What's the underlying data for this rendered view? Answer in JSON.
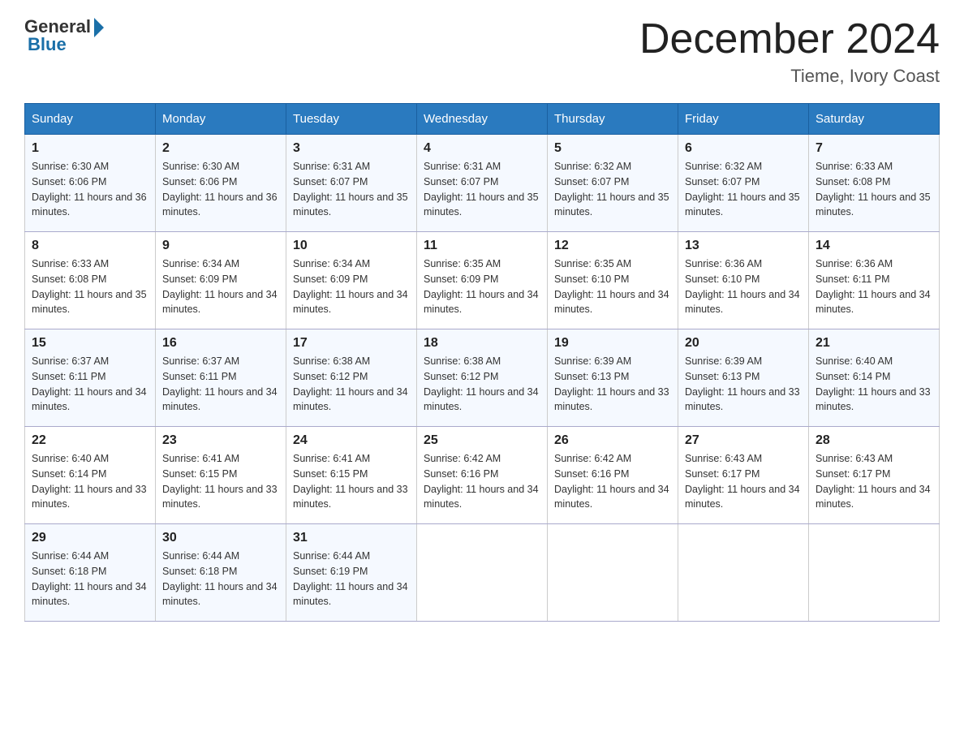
{
  "logo": {
    "general": "General",
    "blue": "Blue"
  },
  "title": "December 2024",
  "location": "Tieme, Ivory Coast",
  "days_of_week": [
    "Sunday",
    "Monday",
    "Tuesday",
    "Wednesday",
    "Thursday",
    "Friday",
    "Saturday"
  ],
  "weeks": [
    [
      {
        "day": "1",
        "sunrise": "6:30 AM",
        "sunset": "6:06 PM",
        "daylight": "11 hours and 36 minutes."
      },
      {
        "day": "2",
        "sunrise": "6:30 AM",
        "sunset": "6:06 PM",
        "daylight": "11 hours and 36 minutes."
      },
      {
        "day": "3",
        "sunrise": "6:31 AM",
        "sunset": "6:07 PM",
        "daylight": "11 hours and 35 minutes."
      },
      {
        "day": "4",
        "sunrise": "6:31 AM",
        "sunset": "6:07 PM",
        "daylight": "11 hours and 35 minutes."
      },
      {
        "day": "5",
        "sunrise": "6:32 AM",
        "sunset": "6:07 PM",
        "daylight": "11 hours and 35 minutes."
      },
      {
        "day": "6",
        "sunrise": "6:32 AM",
        "sunset": "6:07 PM",
        "daylight": "11 hours and 35 minutes."
      },
      {
        "day": "7",
        "sunrise": "6:33 AM",
        "sunset": "6:08 PM",
        "daylight": "11 hours and 35 minutes."
      }
    ],
    [
      {
        "day": "8",
        "sunrise": "6:33 AM",
        "sunset": "6:08 PM",
        "daylight": "11 hours and 35 minutes."
      },
      {
        "day": "9",
        "sunrise": "6:34 AM",
        "sunset": "6:09 PM",
        "daylight": "11 hours and 34 minutes."
      },
      {
        "day": "10",
        "sunrise": "6:34 AM",
        "sunset": "6:09 PM",
        "daylight": "11 hours and 34 minutes."
      },
      {
        "day": "11",
        "sunrise": "6:35 AM",
        "sunset": "6:09 PM",
        "daylight": "11 hours and 34 minutes."
      },
      {
        "day": "12",
        "sunrise": "6:35 AM",
        "sunset": "6:10 PM",
        "daylight": "11 hours and 34 minutes."
      },
      {
        "day": "13",
        "sunrise": "6:36 AM",
        "sunset": "6:10 PM",
        "daylight": "11 hours and 34 minutes."
      },
      {
        "day": "14",
        "sunrise": "6:36 AM",
        "sunset": "6:11 PM",
        "daylight": "11 hours and 34 minutes."
      }
    ],
    [
      {
        "day": "15",
        "sunrise": "6:37 AM",
        "sunset": "6:11 PM",
        "daylight": "11 hours and 34 minutes."
      },
      {
        "day": "16",
        "sunrise": "6:37 AM",
        "sunset": "6:11 PM",
        "daylight": "11 hours and 34 minutes."
      },
      {
        "day": "17",
        "sunrise": "6:38 AM",
        "sunset": "6:12 PM",
        "daylight": "11 hours and 34 minutes."
      },
      {
        "day": "18",
        "sunrise": "6:38 AM",
        "sunset": "6:12 PM",
        "daylight": "11 hours and 34 minutes."
      },
      {
        "day": "19",
        "sunrise": "6:39 AM",
        "sunset": "6:13 PM",
        "daylight": "11 hours and 33 minutes."
      },
      {
        "day": "20",
        "sunrise": "6:39 AM",
        "sunset": "6:13 PM",
        "daylight": "11 hours and 33 minutes."
      },
      {
        "day": "21",
        "sunrise": "6:40 AM",
        "sunset": "6:14 PM",
        "daylight": "11 hours and 33 minutes."
      }
    ],
    [
      {
        "day": "22",
        "sunrise": "6:40 AM",
        "sunset": "6:14 PM",
        "daylight": "11 hours and 33 minutes."
      },
      {
        "day": "23",
        "sunrise": "6:41 AM",
        "sunset": "6:15 PM",
        "daylight": "11 hours and 33 minutes."
      },
      {
        "day": "24",
        "sunrise": "6:41 AM",
        "sunset": "6:15 PM",
        "daylight": "11 hours and 33 minutes."
      },
      {
        "day": "25",
        "sunrise": "6:42 AM",
        "sunset": "6:16 PM",
        "daylight": "11 hours and 34 minutes."
      },
      {
        "day": "26",
        "sunrise": "6:42 AM",
        "sunset": "6:16 PM",
        "daylight": "11 hours and 34 minutes."
      },
      {
        "day": "27",
        "sunrise": "6:43 AM",
        "sunset": "6:17 PM",
        "daylight": "11 hours and 34 minutes."
      },
      {
        "day": "28",
        "sunrise": "6:43 AM",
        "sunset": "6:17 PM",
        "daylight": "11 hours and 34 minutes."
      }
    ],
    [
      {
        "day": "29",
        "sunrise": "6:44 AM",
        "sunset": "6:18 PM",
        "daylight": "11 hours and 34 minutes."
      },
      {
        "day": "30",
        "sunrise": "6:44 AM",
        "sunset": "6:18 PM",
        "daylight": "11 hours and 34 minutes."
      },
      {
        "day": "31",
        "sunrise": "6:44 AM",
        "sunset": "6:19 PM",
        "daylight": "11 hours and 34 minutes."
      },
      null,
      null,
      null,
      null
    ]
  ],
  "labels": {
    "sunrise": "Sunrise:",
    "sunset": "Sunset:",
    "daylight": "Daylight:"
  }
}
